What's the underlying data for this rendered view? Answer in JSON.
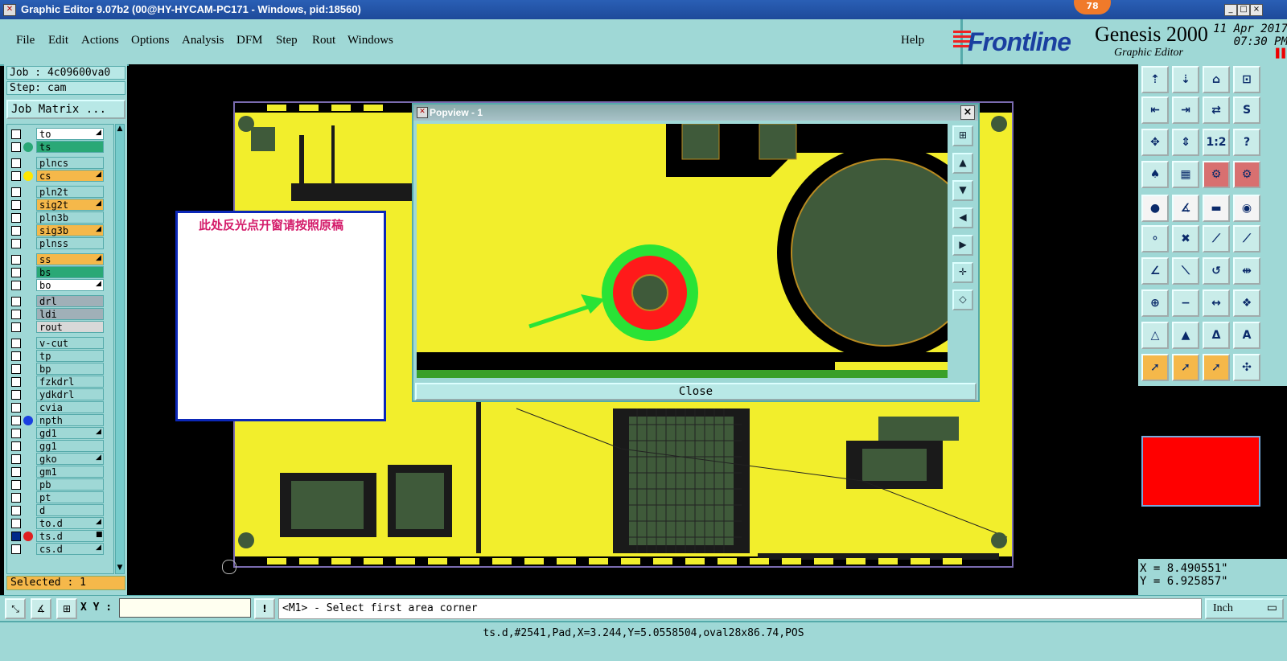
{
  "window": {
    "title": "Graphic Editor 9.07b2 (00@HY-HYCAM-PC171 - Windows, pid:18560)",
    "badge": "78",
    "minimize": "_",
    "restore": "□",
    "close": "×"
  },
  "menu": {
    "items": [
      "File",
      "Edit",
      "Actions",
      "Options",
      "Analysis",
      "DFM",
      "Step",
      "Rout",
      "Windows"
    ],
    "help": "Help"
  },
  "brand": {
    "logo": "Frontline",
    "product": "Genesis 2000",
    "subtitle": "Graphic Editor",
    "date": "11 Apr 2017",
    "time": "07:30 PM"
  },
  "job": {
    "job_label": "Job : 4c09600va0",
    "step_label": "Step: cam",
    "matrix_button": "Job Matrix ..."
  },
  "layers": [
    {
      "name": "to",
      "bg": "#ffffff",
      "dot": "",
      "marker": "◢",
      "checked": false
    },
    {
      "name": "ts",
      "bg": "#2aa876",
      "dot": "#2aa876",
      "marker": "",
      "checked": false
    },
    {
      "name": "plncs",
      "bg": "#9fd8d6",
      "dot": "",
      "marker": "",
      "checked": false
    },
    {
      "name": "cs",
      "bg": "#f5b84a",
      "dot": "#ffe600",
      "marker": "◢",
      "checked": false
    },
    {
      "name": "pln2t",
      "bg": "#9fd8d6",
      "dot": "",
      "marker": "",
      "checked": false
    },
    {
      "name": "sig2t",
      "bg": "#f5b84a",
      "dot": "",
      "marker": "◢",
      "checked": false
    },
    {
      "name": "pln3b",
      "bg": "#9fd8d6",
      "dot": "",
      "marker": "",
      "checked": false
    },
    {
      "name": "sig3b",
      "bg": "#f5b84a",
      "dot": "",
      "marker": "◢",
      "checked": false
    },
    {
      "name": "plnss",
      "bg": "#9fd8d6",
      "dot": "",
      "marker": "",
      "checked": false
    },
    {
      "name": "ss",
      "bg": "#f5b84a",
      "dot": "",
      "marker": "◢",
      "checked": false
    },
    {
      "name": "bs",
      "bg": "#2aa876",
      "dot": "",
      "marker": "",
      "checked": false
    },
    {
      "name": "bo",
      "bg": "#ffffff",
      "dot": "",
      "marker": "◢",
      "checked": false
    },
    {
      "name": "drl",
      "bg": "#a0b0b8",
      "dot": "",
      "marker": "",
      "checked": false
    },
    {
      "name": "ldi",
      "bg": "#a0b0b8",
      "dot": "",
      "marker": "",
      "checked": false
    },
    {
      "name": "rout",
      "bg": "#d8d8d8",
      "dot": "",
      "marker": "",
      "checked": false
    },
    {
      "name": "v-cut",
      "bg": "#9fd8d6",
      "dot": "",
      "marker": "",
      "checked": false
    },
    {
      "name": "tp",
      "bg": "#9fd8d6",
      "dot": "",
      "marker": "",
      "checked": false
    },
    {
      "name": "bp",
      "bg": "#9fd8d6",
      "dot": "",
      "marker": "",
      "checked": false
    },
    {
      "name": "fzkdrl",
      "bg": "#9fd8d6",
      "dot": "",
      "marker": "",
      "checked": false
    },
    {
      "name": "ydkdrl",
      "bg": "#9fd8d6",
      "dot": "",
      "marker": "",
      "checked": false
    },
    {
      "name": "cvia",
      "bg": "#9fd8d6",
      "dot": "",
      "marker": "",
      "checked": false
    },
    {
      "name": "npth",
      "bg": "#9fd8d6",
      "dot": "#1a3fe0",
      "marker": "",
      "checked": false
    },
    {
      "name": "gd1",
      "bg": "#9fd8d6",
      "dot": "",
      "marker": "◢",
      "checked": false
    },
    {
      "name": "gg1",
      "bg": "#9fd8d6",
      "dot": "",
      "marker": "",
      "checked": false
    },
    {
      "name": "gko",
      "bg": "#9fd8d6",
      "dot": "",
      "marker": "◢",
      "checked": false
    },
    {
      "name": "gm1",
      "bg": "#9fd8d6",
      "dot": "",
      "marker": "",
      "checked": false
    },
    {
      "name": "pb",
      "bg": "#9fd8d6",
      "dot": "",
      "marker": "",
      "checked": false
    },
    {
      "name": "pt",
      "bg": "#9fd8d6",
      "dot": "",
      "marker": "",
      "checked": false
    },
    {
      "name": "d",
      "bg": "#9fd8d6",
      "dot": "",
      "marker": "",
      "checked": false
    },
    {
      "name": "to.d",
      "bg": "#9fd8d6",
      "dot": "",
      "marker": "◢",
      "checked": false
    },
    {
      "name": "ts.d",
      "bg": "#9fd8d6",
      "dot": "#e02020",
      "marker": "■",
      "checked": true
    },
    {
      "name": "cs.d",
      "bg": "#9fd8d6",
      "dot": "",
      "marker": "◢",
      "checked": false
    }
  ],
  "selected": "Selected : 1",
  "note": {
    "text": "此处反光点开窗请按照原稿"
  },
  "popview": {
    "title": "Popview - 1",
    "close_label": "Close",
    "close_x": "×"
  },
  "coords": {
    "x": "X =  8.490551\"",
    "y": "Y =  6.925857\""
  },
  "bottom": {
    "xy_label": "X Y :",
    "xy_value": "",
    "warn": "!",
    "prompt": "<M1> - Select first area corner",
    "units": "Inch"
  },
  "status": "ts.d,#2541,Pad,X=3.244,Y=5.0558504,oval28x86.74,POS",
  "colors": {
    "accent": "#9fd8d6",
    "copper": "#f2ee2c",
    "highlight": "#ff0000",
    "target_ring": "#29e336"
  }
}
